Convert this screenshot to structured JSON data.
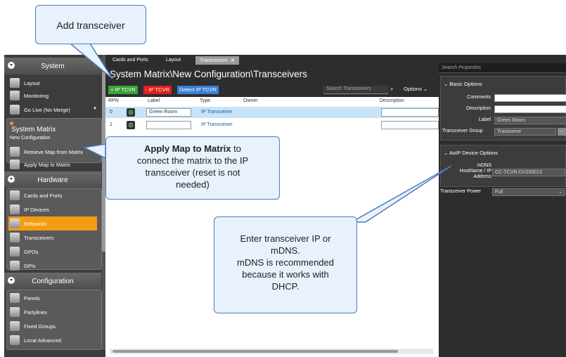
{
  "callouts": {
    "add_transceiver": "Add transceiver",
    "apply_map_bold": "Apply Map to Matrix",
    "apply_map_rest_1": " to",
    "apply_map_line2": "connect the matrix to the IP",
    "apply_map_line3": "transceiver (reset is not",
    "apply_map_line4": "needed)",
    "enter_ip_line1": "Enter transceiver IP or",
    "enter_ip_line2": "mDNS.",
    "enter_ip_line3": "mDNS is recommended",
    "enter_ip_line4": "because it works with",
    "enter_ip_line5": "DHCP."
  },
  "sidebar": {
    "system": {
      "header": "System",
      "items": [
        {
          "label": "Layout",
          "icon": "layout-icon"
        },
        {
          "label": "Monitoring",
          "icon": "monitoring-icon"
        },
        {
          "label": "Go Live (No Merge)",
          "icon": "go-live-icon"
        }
      ]
    },
    "system_matrix": {
      "header": "System Matrix",
      "subheader": "New Configuration",
      "items": [
        {
          "label": "Retrieve Map from Matrix",
          "icon": "retrieve-map-icon"
        },
        {
          "label": "Apply Map to Matrix",
          "icon": "apply-map-icon"
        }
      ]
    },
    "hardware": {
      "header": "Hardware",
      "items": [
        {
          "label": "Cards and Ports",
          "icon": "cards-ports-icon"
        },
        {
          "label": "IP Devices",
          "icon": "ip-devices-icon"
        },
        {
          "label": "Beltpacks",
          "icon": "beltpacks-icon"
        },
        {
          "label": "Transceivers",
          "icon": "transceivers-icon"
        },
        {
          "label": "GPOs",
          "icon": "gpos-icon"
        },
        {
          "label": "GPIs",
          "icon": "gpis-icon"
        }
      ]
    },
    "configuration": {
      "header": "Configuration",
      "items": [
        {
          "label": "Panels",
          "icon": "panels-icon"
        },
        {
          "label": "Partylines",
          "icon": "partylines-icon"
        },
        {
          "label": "Fixed Groups",
          "icon": "fixed-groups-icon"
        },
        {
          "label": "Local Advanced",
          "icon": "local-advanced-icon"
        }
      ]
    }
  },
  "tabs": [
    {
      "label": "Cards and Ports"
    },
    {
      "label": "Layout"
    },
    {
      "label": "Transceivers",
      "close": "✕"
    }
  ],
  "center": {
    "path": "System Matrix\\New Configuration\\Transceivers",
    "add_ip_tcvr": "+ IP TCVR",
    "remove_ip_tcvr": "- IP TCVR",
    "detect_ip_tcvr": "Detect IP TCVR",
    "search_placeholder": "Search Transceivers",
    "options": "Options",
    "columns": [
      "RPN",
      "Label",
      "Type",
      "Owner",
      "Description"
    ],
    "rows": [
      {
        "rpn": "0",
        "label": "Green Room",
        "type": "IP Transceiver",
        "owner": "",
        "description": ""
      },
      {
        "rpn": "1",
        "label": "",
        "type": "IP Transceiver",
        "owner": "",
        "description": ""
      }
    ]
  },
  "properties": {
    "search_placeholder": "Search Properties",
    "basic_header": "Basic Options",
    "comments_label": "Comments",
    "comments_value": "",
    "description_label": "Description",
    "description_value": "",
    "label_label": "Label",
    "label_value": "Green Room",
    "group_label": "Transceiver Group",
    "group_value": "Transceive",
    "group_btn": "...",
    "aoip_header": "AoIP Device Options",
    "mdns_label_1": "mDNS",
    "mdns_label_2": "HostName / IP",
    "mdns_label_3": "Address",
    "mdns_value": "CC-TCVR-DV200013",
    "power_label": "Transceiver Power",
    "power_value": "Full"
  },
  "colors": {
    "add_green": "#3aa335",
    "remove_red": "#e0201a",
    "detect_blue": "#3a7fd5",
    "selected_orange": "#f39c12",
    "row_highlight": "#c8e4f8"
  }
}
